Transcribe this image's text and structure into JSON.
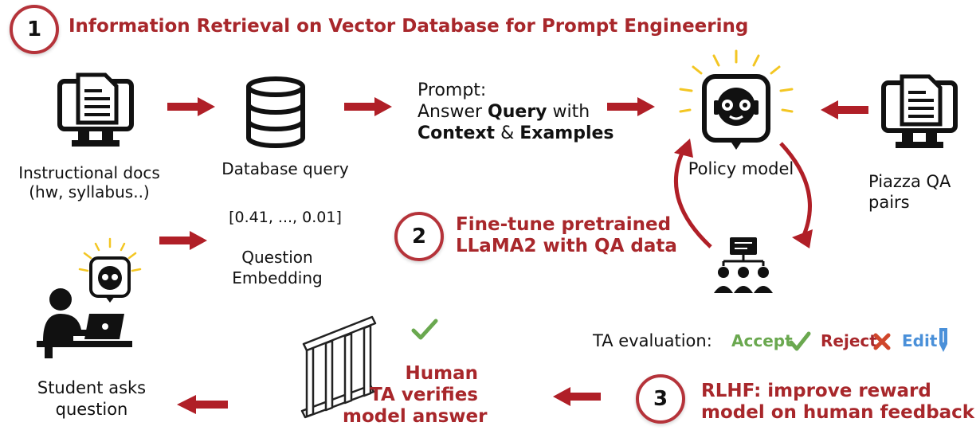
{
  "step1": {
    "number": "1",
    "title": "Information Retrieval on Vector Database for Prompt Engineering"
  },
  "step2": {
    "number": "2",
    "line1": "Fine-tune pretrained",
    "line2": "LLaMA2 with QA data"
  },
  "step3": {
    "number": "3",
    "line1": "RLHF: improve reward",
    "line2": "model on human feedback"
  },
  "nodes": {
    "docs": {
      "line1": "Instructional docs",
      "line2": "(hw, syllabus..)"
    },
    "database": {
      "label": "Database query"
    },
    "prompt": {
      "line1": "Prompt:",
      "line2_pre": "Answer ",
      "line2_bold": "Query",
      "line2_post": " with",
      "line3_bold1": "Context",
      "line3_mid": " & ",
      "line3_bold2": "Examples"
    },
    "policy": {
      "label": "Policy model"
    },
    "piazza": {
      "line1": "Piazza QA",
      "line2": "pairs"
    },
    "embedding": {
      "vector": "[0.41, ..., 0.01]",
      "line1": "Question",
      "line2": "Embedding"
    },
    "student": {
      "line1": "Student asks",
      "line2": "question"
    },
    "human_ta": {
      "line1": "Human",
      "line2": "TA verifies",
      "line3": "model answer"
    }
  },
  "ta_evaluation": {
    "label": "TA evaluation:",
    "accept": "Accept",
    "reject": "Reject",
    "edit": "Edit",
    "accept_color": "#6aa84f",
    "reject_color": "#a8272b",
    "edit_color": "#4a90d9"
  },
  "colors": {
    "accent": "#a8272b",
    "arrow": "#b01f27",
    "check": "#6aa84f"
  }
}
